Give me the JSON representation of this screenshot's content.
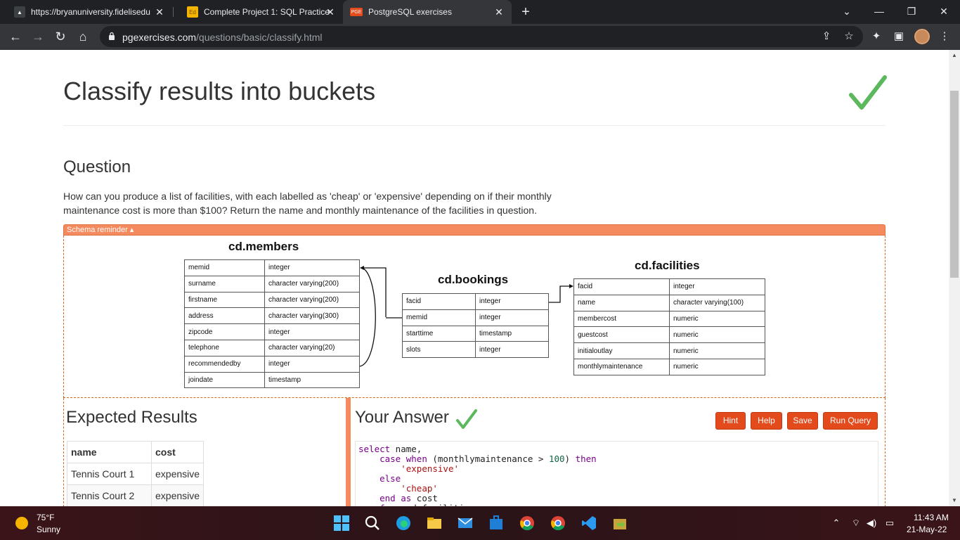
{
  "browser": {
    "tabs": [
      {
        "title": "https://bryanuniversity.fidelisedu",
        "active": false
      },
      {
        "title": "Complete Project 1: SQL Practice",
        "active": false
      },
      {
        "title": "PostgreSQL exercises",
        "active": true
      }
    ],
    "favicon_pge": "PGE",
    "favicon_doc": "Ed",
    "url_host": "pgexercises.com",
    "url_path": "/questions/basic/classify.html"
  },
  "page": {
    "title": "Classify results into buckets",
    "question_heading": "Question",
    "question_text": "How can you produce a list of facilities, with each labelled as 'cheap' or 'expensive' depending on if their monthly maintenance cost is more than $100? Return the name and monthly maintenance of the facilities in question.",
    "schema_toggle": "Schema reminder ▴",
    "colors": {
      "accent": "#f58a5e",
      "button": "#e34a1c",
      "check": "#5cb85c"
    }
  },
  "schema": {
    "members": {
      "title": "cd.members",
      "rows": [
        [
          "memid",
          "integer"
        ],
        [
          "surname",
          "character varying(200)"
        ],
        [
          "firstname",
          "character varying(200)"
        ],
        [
          "address",
          "character varying(300)"
        ],
        [
          "zipcode",
          "integer"
        ],
        [
          "telephone",
          "character varying(20)"
        ],
        [
          "recommendedby",
          "integer"
        ],
        [
          "joindate",
          "timestamp"
        ]
      ]
    },
    "bookings": {
      "title": "cd.bookings",
      "rows": [
        [
          "facid",
          "integer"
        ],
        [
          "memid",
          "integer"
        ],
        [
          "starttime",
          "timestamp"
        ],
        [
          "slots",
          "integer"
        ]
      ]
    },
    "facilities": {
      "title": "cd.facilities",
      "rows": [
        [
          "facid",
          "integer"
        ],
        [
          "name",
          "character varying(100)"
        ],
        [
          "membercost",
          "numeric"
        ],
        [
          "guestcost",
          "numeric"
        ],
        [
          "initialoutlay",
          "numeric"
        ],
        [
          "monthlymaintenance",
          "numeric"
        ]
      ]
    }
  },
  "expected": {
    "heading": "Expected Results",
    "columns": [
      "name",
      "cost"
    ],
    "rows": [
      [
        "Tennis Court 1",
        "expensive"
      ],
      [
        "Tennis Court 2",
        "expensive"
      ]
    ]
  },
  "answer": {
    "heading": "Your Answer",
    "buttons": {
      "hint": "Hint",
      "help": "Help",
      "save": "Save",
      "run": "Run Query"
    }
  },
  "taskbar": {
    "temperature": "75°F",
    "weather": "Sunny",
    "time": "11:43 AM",
    "date": "21-May-22"
  }
}
